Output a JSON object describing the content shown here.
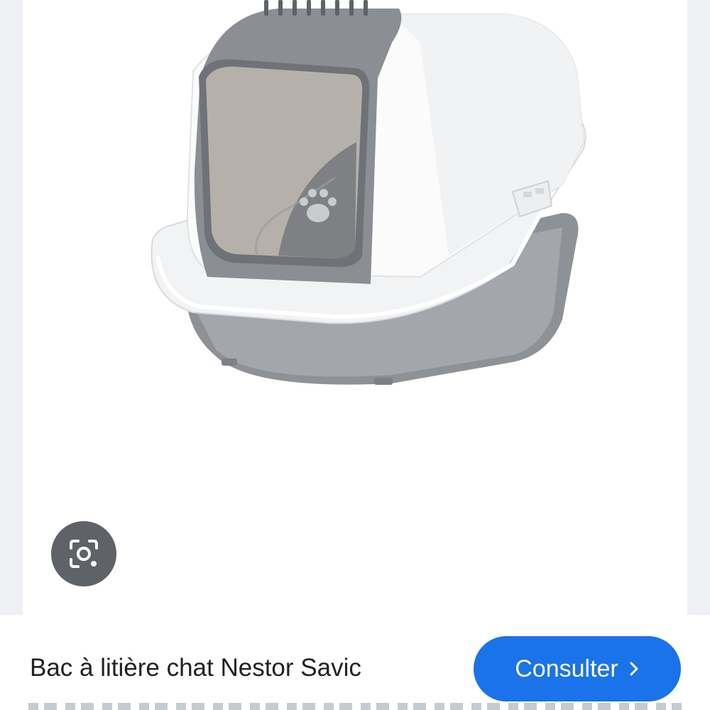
{
  "product": {
    "title": "Bac à litière chat Nestor Savic",
    "image_description_icon": "cat-litter-box-image"
  },
  "actions": {
    "consult_label": "Consulter",
    "consult_icon": "chevron-right-icon",
    "lens_icon": "visual-search-icon"
  },
  "colors": {
    "accent": "#1a73e8",
    "lens_button": "#5f6266",
    "panel_background": "#eef0f3"
  }
}
